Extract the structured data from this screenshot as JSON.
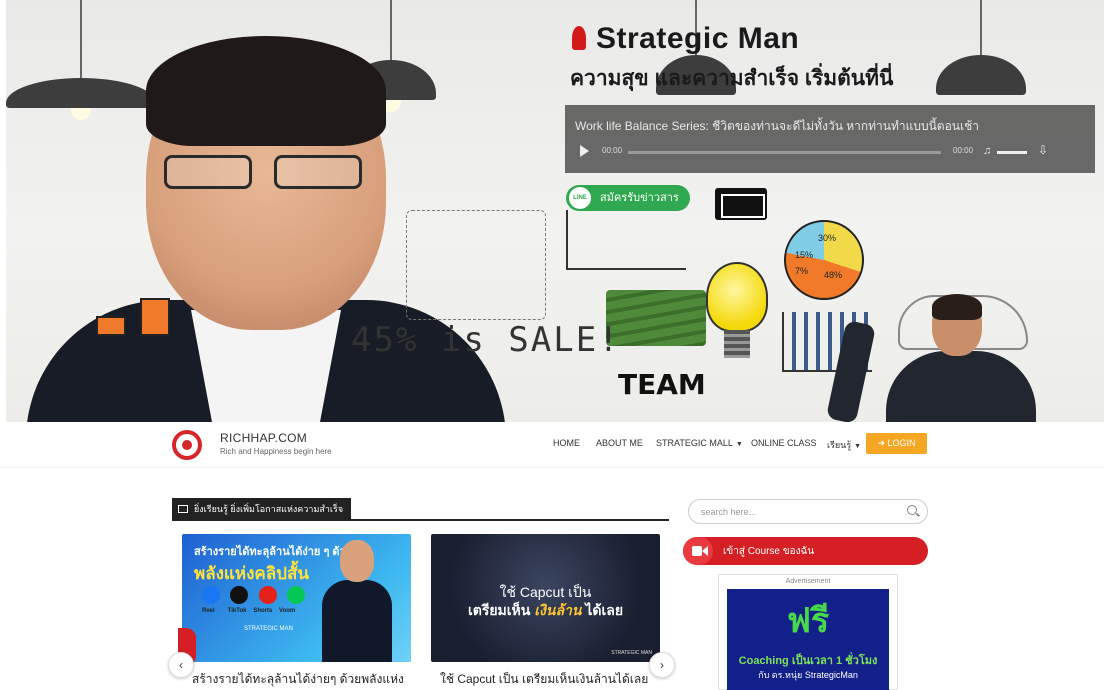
{
  "hero": {
    "brand_title": "Strategic Man",
    "tagline": "ความสุข และความสำเร็จ เริ่มต้นที่นี่",
    "player": {
      "title": "Work life Balance Series: ชีวิตของท่านจะดีไม่ทั้งวัน หากท่านทำแบบนี้ตอนเช้า",
      "current_time": "00:00",
      "duration": "00:00",
      "icons": [
        "play-icon",
        "volume-icon",
        "download-icon"
      ]
    },
    "subscribe": {
      "badge": "LINE",
      "label": "สมัครรับข่าวสาร"
    },
    "pie_labels": [
      "30%",
      "15%",
      "7%",
      "48%"
    ],
    "sale_text": "45% is SALE!",
    "team_text": "TEAM"
  },
  "nav": {
    "site_name": "RICHHAP.COM",
    "site_tagline": "Rich and Happiness begin here",
    "menu": [
      {
        "label": "HOME",
        "dropdown": false
      },
      {
        "label": "ABOUT ME",
        "dropdown": false
      },
      {
        "label": "STRATEGIC MALL",
        "dropdown": true
      },
      {
        "label": "ONLINE CLASS",
        "dropdown": false
      },
      {
        "label": "เรียนรู้",
        "dropdown": true
      }
    ],
    "login_label": "LOGIN",
    "accent": "#f5a623"
  },
  "content": {
    "section_title": "ยิ่งเรียนรู้ ยิ่งเพิ่มโอกาสแห่งความสำเร็จ",
    "cards": [
      {
        "line1": "สร้างรายได้ทะลุล้านได้ง่าย ๆ ด้วย",
        "line2": "พลังแห่งคลิปสั้น",
        "platforms": [
          "Reel",
          "TikTok",
          "Shorts",
          "Voom"
        ],
        "brand": "STRATEGIC MAN",
        "caption": "สร้างรายได้ทะลุล้านได้ง่ายๆ ด้วยพลังแห่ง"
      },
      {
        "line1": "ใช้ Capcut เป็น",
        "line2a": "เตรียมเห็น ",
        "line2b": "เงินล้าน",
        "line2c": " ได้เลย",
        "brand": "STRATEGIC MAN",
        "caption": "ใช้ Capcut เป็น เตรียมเห็นเงินล้านได้เลย"
      }
    ],
    "prev_arrow": "‹",
    "next_arrow": "›"
  },
  "sidebar": {
    "search_placeholder": "search here...",
    "course_button": "เข้าสู่ Course ของฉัน",
    "ad": {
      "label": "Advertisement",
      "headline": "ฟรี",
      "line": "Coaching เป็นเวลา 1 ชั่วโมง",
      "sub": "กับ ดร.หนุ่ย StrategicMan"
    },
    "accent": "#d61f25"
  }
}
